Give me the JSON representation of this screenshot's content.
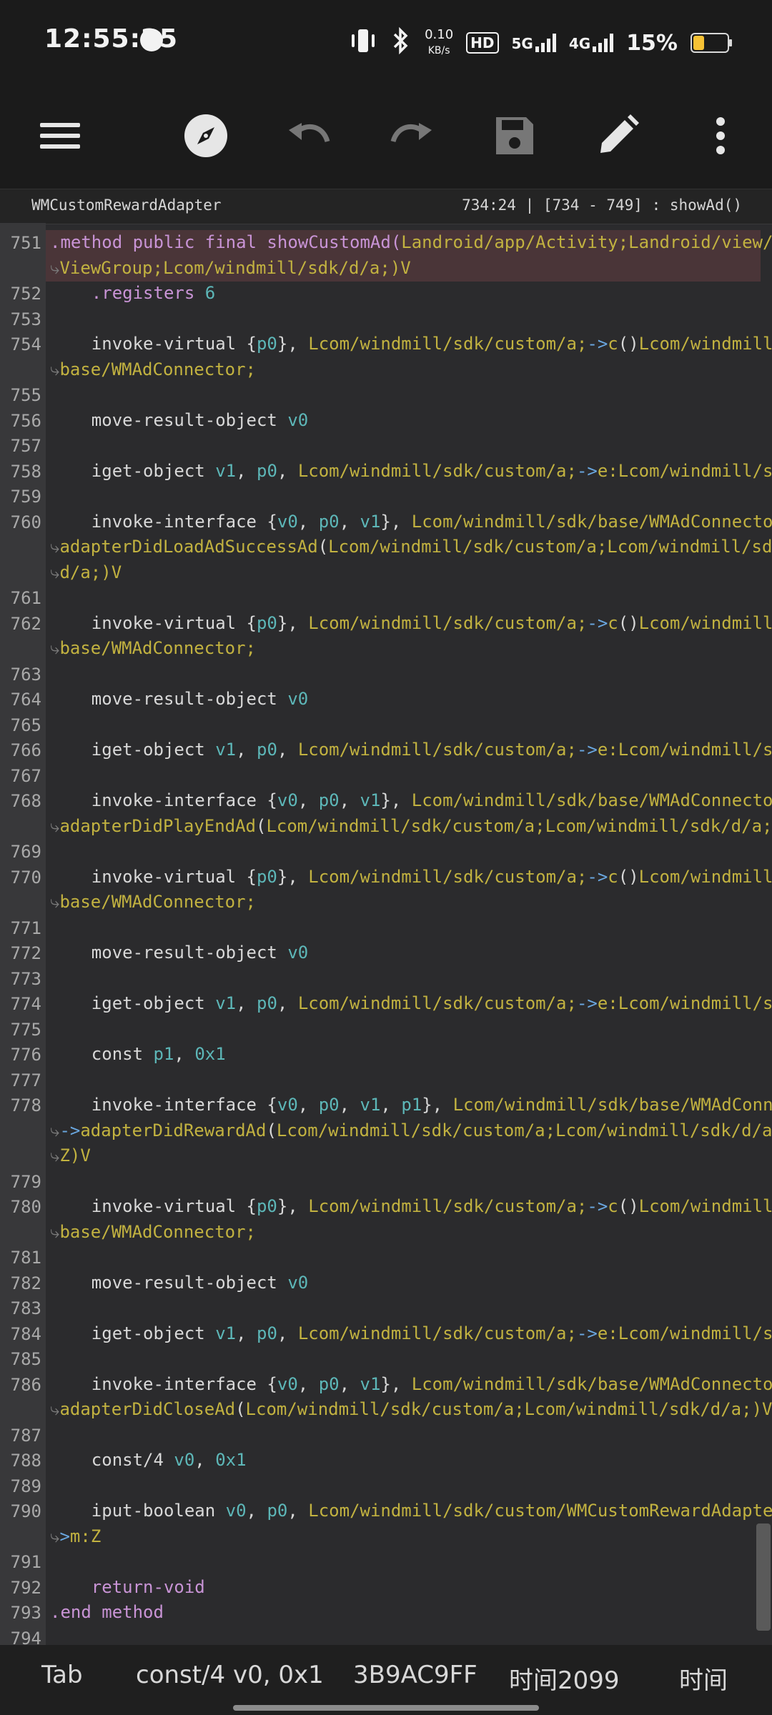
{
  "status": {
    "time": "12:55:25",
    "net_speed_value": "0.10",
    "net_speed_unit": "KB/s",
    "hd": "HD",
    "network_5g": "5G",
    "network_4g": "4G",
    "battery_percent": "15%",
    "battery_level": 0.15
  },
  "toolbar": {
    "icons": [
      "menu-icon",
      "compass-icon",
      "undo-icon",
      "redo-icon",
      "save-icon",
      "edit-icon",
      "more-vertical-icon"
    ]
  },
  "pathbar": {
    "file_name": "WMCustomRewardAdapter",
    "cursor_info": "734:24  |  [734 - 749] : showAd()"
  },
  "code_lines": [
    {
      "n": "751",
      "segs": [
        [
          ".method public final showCustomAd(",
          "dir"
        ],
        [
          "Landroid/app/Activity;Landroid/view/",
          "typ"
        ],
        [
          " ⤦",
          "wrap-marker"
        ]
      ]
    },
    {
      "n": "",
      "segs": [
        [
          "⤷",
          "wrap-marker"
        ],
        [
          "ViewGroup;Lcom/windmill/sdk/d/a;",
          "typ"
        ],
        [
          ")V",
          "typ"
        ]
      ]
    },
    {
      "n": "752",
      "segs": [
        [
          "    .registers ",
          "dir"
        ],
        [
          "6",
          "num"
        ]
      ]
    },
    {
      "n": "753",
      "segs": []
    },
    {
      "n": "754",
      "segs": [
        [
          "    invoke-virtual {",
          "plain"
        ],
        [
          "p0",
          "reg"
        ],
        [
          "}, ",
          "plain"
        ],
        [
          "Lcom/windmill/sdk/custom/a;",
          "typ"
        ],
        [
          "->",
          "arr"
        ],
        [
          "c",
          "m"
        ],
        [
          "()",
          "plain"
        ],
        [
          "Lcom/windmill/sdk/",
          "typ"
        ],
        [
          " ⤦",
          "wrap-marker"
        ]
      ]
    },
    {
      "n": "",
      "segs": [
        [
          "⤷",
          "wrap-marker"
        ],
        [
          "base/WMAdConnector;",
          "typ"
        ]
      ]
    },
    {
      "n": "755",
      "segs": []
    },
    {
      "n": "756",
      "segs": [
        [
          "    move-result-object ",
          "plain"
        ],
        [
          "v0",
          "reg"
        ]
      ]
    },
    {
      "n": "757",
      "segs": []
    },
    {
      "n": "758",
      "segs": [
        [
          "    iget-object ",
          "plain"
        ],
        [
          "v1",
          "reg"
        ],
        [
          ", ",
          "plain"
        ],
        [
          "p0",
          "reg"
        ],
        [
          ", ",
          "plain"
        ],
        [
          "Lcom/windmill/sdk/custom/a;",
          "typ"
        ],
        [
          "->",
          "arr"
        ],
        [
          "e:",
          "m"
        ],
        [
          "Lcom/windmill/sdk/d/a;",
          "typ"
        ]
      ]
    },
    {
      "n": "759",
      "segs": []
    },
    {
      "n": "760",
      "segs": [
        [
          "    invoke-interface {",
          "plain"
        ],
        [
          "v0",
          "reg"
        ],
        [
          ", ",
          "plain"
        ],
        [
          "p0",
          "reg"
        ],
        [
          ", ",
          "plain"
        ],
        [
          "v1",
          "reg"
        ],
        [
          "}, ",
          "plain"
        ],
        [
          "Lcom/windmill/sdk/base/WMAdConnector;",
          "typ"
        ],
        [
          "->",
          "arr"
        ],
        [
          " ⤦",
          "wrap-marker"
        ]
      ]
    },
    {
      "n": "",
      "segs": [
        [
          "⤷",
          "wrap-marker"
        ],
        [
          "adapterDidLoadAdSuccessAd",
          "m"
        ],
        [
          "(",
          "plain"
        ],
        [
          "Lcom/windmill/sdk/custom/a;Lcom/windmill/sdk/",
          "typ"
        ],
        [
          "⤦",
          "wrap-marker"
        ]
      ]
    },
    {
      "n": "",
      "segs": [
        [
          "⤷",
          "wrap-marker"
        ],
        [
          "d/a;",
          "typ"
        ],
        [
          ")V",
          "typ"
        ]
      ]
    },
    {
      "n": "761",
      "segs": []
    },
    {
      "n": "762",
      "segs": [
        [
          "    invoke-virtual {",
          "plain"
        ],
        [
          "p0",
          "reg"
        ],
        [
          "}, ",
          "plain"
        ],
        [
          "Lcom/windmill/sdk/custom/a;",
          "typ"
        ],
        [
          "->",
          "arr"
        ],
        [
          "c",
          "m"
        ],
        [
          "()",
          "plain"
        ],
        [
          "Lcom/windmill/sdk/",
          "typ"
        ],
        [
          " ⤦",
          "wrap-marker"
        ]
      ]
    },
    {
      "n": "",
      "segs": [
        [
          "⤷",
          "wrap-marker"
        ],
        [
          "base/WMAdConnector;",
          "typ"
        ]
      ]
    },
    {
      "n": "763",
      "segs": []
    },
    {
      "n": "764",
      "segs": [
        [
          "    move-result-object ",
          "plain"
        ],
        [
          "v0",
          "reg"
        ]
      ]
    },
    {
      "n": "765",
      "segs": []
    },
    {
      "n": "766",
      "segs": [
        [
          "    iget-object ",
          "plain"
        ],
        [
          "v1",
          "reg"
        ],
        [
          ", ",
          "plain"
        ],
        [
          "p0",
          "reg"
        ],
        [
          ", ",
          "plain"
        ],
        [
          "Lcom/windmill/sdk/custom/a;",
          "typ"
        ],
        [
          "->",
          "arr"
        ],
        [
          "e:",
          "m"
        ],
        [
          "Lcom/windmill/sdk/d/a;",
          "typ"
        ]
      ]
    },
    {
      "n": "767",
      "segs": []
    },
    {
      "n": "768",
      "segs": [
        [
          "    invoke-interface {",
          "plain"
        ],
        [
          "v0",
          "reg"
        ],
        [
          ", ",
          "plain"
        ],
        [
          "p0",
          "reg"
        ],
        [
          ", ",
          "plain"
        ],
        [
          "v1",
          "reg"
        ],
        [
          "}, ",
          "plain"
        ],
        [
          "Lcom/windmill/sdk/base/WMAdConnector;",
          "typ"
        ],
        [
          "->",
          "arr"
        ],
        [
          " ⤦",
          "wrap-marker"
        ]
      ]
    },
    {
      "n": "",
      "segs": [
        [
          "⤷",
          "wrap-marker"
        ],
        [
          "adapterDidPlayEndAd",
          "m"
        ],
        [
          "(",
          "plain"
        ],
        [
          "Lcom/windmill/sdk/custom/a;Lcom/windmill/sdk/d/a;",
          "typ"
        ],
        [
          ")V",
          "typ"
        ]
      ]
    },
    {
      "n": "769",
      "segs": []
    },
    {
      "n": "770",
      "segs": [
        [
          "    invoke-virtual {",
          "plain"
        ],
        [
          "p0",
          "reg"
        ],
        [
          "}, ",
          "plain"
        ],
        [
          "Lcom/windmill/sdk/custom/a;",
          "typ"
        ],
        [
          "->",
          "arr"
        ],
        [
          "c",
          "m"
        ],
        [
          "()",
          "plain"
        ],
        [
          "Lcom/windmill/sdk/",
          "typ"
        ],
        [
          " ⤦",
          "wrap-marker"
        ]
      ]
    },
    {
      "n": "",
      "segs": [
        [
          "⤷",
          "wrap-marker"
        ],
        [
          "base/WMAdConnector;",
          "typ"
        ]
      ]
    },
    {
      "n": "771",
      "segs": []
    },
    {
      "n": "772",
      "segs": [
        [
          "    move-result-object ",
          "plain"
        ],
        [
          "v0",
          "reg"
        ]
      ]
    },
    {
      "n": "773",
      "segs": []
    },
    {
      "n": "774",
      "segs": [
        [
          "    iget-object ",
          "plain"
        ],
        [
          "v1",
          "reg"
        ],
        [
          ", ",
          "plain"
        ],
        [
          "p0",
          "reg"
        ],
        [
          ", ",
          "plain"
        ],
        [
          "Lcom/windmill/sdk/custom/a;",
          "typ"
        ],
        [
          "->",
          "arr"
        ],
        [
          "e:",
          "m"
        ],
        [
          "Lcom/windmill/sdk/d/a;",
          "typ"
        ]
      ]
    },
    {
      "n": "775",
      "segs": []
    },
    {
      "n": "776",
      "segs": [
        [
          "    const ",
          "plain"
        ],
        [
          "p1",
          "reg"
        ],
        [
          ", ",
          "plain"
        ],
        [
          "0x1",
          "num"
        ]
      ]
    },
    {
      "n": "777",
      "segs": []
    },
    {
      "n": "778",
      "segs": [
        [
          "    invoke-interface {",
          "plain"
        ],
        [
          "v0",
          "reg"
        ],
        [
          ", ",
          "plain"
        ],
        [
          "p0",
          "reg"
        ],
        [
          ", ",
          "plain"
        ],
        [
          "v1",
          "reg"
        ],
        [
          ", ",
          "plain"
        ],
        [
          "p1",
          "reg"
        ],
        [
          "}, ",
          "plain"
        ],
        [
          "Lcom/windmill/sdk/base/WMAdConnector;",
          "typ"
        ],
        [
          "⤦",
          "wrap-marker"
        ]
      ]
    },
    {
      "n": "",
      "segs": [
        [
          "⤷",
          "wrap-marker"
        ],
        [
          "->",
          "arr"
        ],
        [
          "adapterDidRewardAd",
          "m"
        ],
        [
          "(",
          "plain"
        ],
        [
          "Lcom/windmill/sdk/custom/a;Lcom/windmill/sdk/d/a;",
          "typ"
        ],
        [
          "⤦",
          "wrap-marker"
        ]
      ]
    },
    {
      "n": "",
      "segs": [
        [
          "⤷",
          "wrap-marker"
        ],
        [
          "Z",
          "typ"
        ],
        [
          ")V",
          "typ"
        ]
      ]
    },
    {
      "n": "779",
      "segs": []
    },
    {
      "n": "780",
      "segs": [
        [
          "    invoke-virtual {",
          "plain"
        ],
        [
          "p0",
          "reg"
        ],
        [
          "}, ",
          "plain"
        ],
        [
          "Lcom/windmill/sdk/custom/a;",
          "typ"
        ],
        [
          "->",
          "arr"
        ],
        [
          "c",
          "m"
        ],
        [
          "()",
          "plain"
        ],
        [
          "Lcom/windmill/sdk/",
          "typ"
        ],
        [
          " ⤦",
          "wrap-marker"
        ]
      ]
    },
    {
      "n": "",
      "segs": [
        [
          "⤷",
          "wrap-marker"
        ],
        [
          "base/WMAdConnector;",
          "typ"
        ]
      ]
    },
    {
      "n": "781",
      "segs": []
    },
    {
      "n": "782",
      "segs": [
        [
          "    move-result-object ",
          "plain"
        ],
        [
          "v0",
          "reg"
        ]
      ]
    },
    {
      "n": "783",
      "segs": []
    },
    {
      "n": "784",
      "segs": [
        [
          "    iget-object ",
          "plain"
        ],
        [
          "v1",
          "reg"
        ],
        [
          ", ",
          "plain"
        ],
        [
          "p0",
          "reg"
        ],
        [
          ", ",
          "plain"
        ],
        [
          "Lcom/windmill/sdk/custom/a;",
          "typ"
        ],
        [
          "->",
          "arr"
        ],
        [
          "e:",
          "m"
        ],
        [
          "Lcom/windmill/sdk/d/a;",
          "typ"
        ]
      ]
    },
    {
      "n": "785",
      "segs": []
    },
    {
      "n": "786",
      "segs": [
        [
          "    invoke-interface {",
          "plain"
        ],
        [
          "v0",
          "reg"
        ],
        [
          ", ",
          "plain"
        ],
        [
          "p0",
          "reg"
        ],
        [
          ", ",
          "plain"
        ],
        [
          "v1",
          "reg"
        ],
        [
          "}, ",
          "plain"
        ],
        [
          "Lcom/windmill/sdk/base/WMAdConnector;",
          "typ"
        ],
        [
          "->",
          "arr"
        ],
        [
          " ⤦",
          "wrap-marker"
        ]
      ]
    },
    {
      "n": "",
      "segs": [
        [
          "⤷",
          "wrap-marker"
        ],
        [
          "adapterDidCloseAd",
          "m"
        ],
        [
          "(",
          "plain"
        ],
        [
          "Lcom/windmill/sdk/custom/a;Lcom/windmill/sdk/d/a;",
          "typ"
        ],
        [
          ")V",
          "typ"
        ]
      ]
    },
    {
      "n": "787",
      "segs": []
    },
    {
      "n": "788",
      "segs": [
        [
          "    const/4 ",
          "plain"
        ],
        [
          "v0",
          "reg"
        ],
        [
          ", ",
          "plain"
        ],
        [
          "0x1",
          "num"
        ]
      ]
    },
    {
      "n": "789",
      "segs": []
    },
    {
      "n": "790",
      "segs": [
        [
          "    iput-boolean ",
          "plain"
        ],
        [
          "v0",
          "reg"
        ],
        [
          ", ",
          "plain"
        ],
        [
          "p0",
          "reg"
        ],
        [
          ", ",
          "plain"
        ],
        [
          "Lcom/windmill/sdk/custom/WMCustomRewardAdapter;",
          "typ"
        ],
        [
          "-",
          "arr"
        ],
        [
          "⤦",
          "wrap-marker"
        ]
      ]
    },
    {
      "n": "",
      "segs": [
        [
          "⤷",
          "wrap-marker"
        ],
        [
          ">",
          "arr"
        ],
        [
          "m:",
          "m"
        ],
        [
          "Z",
          "typ"
        ]
      ]
    },
    {
      "n": "791",
      "segs": []
    },
    {
      "n": "792",
      "segs": [
        [
          "    return-void",
          "dir"
        ]
      ]
    },
    {
      "n": "793",
      "segs": [
        [
          ".end method",
          "dir"
        ]
      ]
    },
    {
      "n": "794",
      "segs": []
    }
  ],
  "bottombar": {
    "tab": "Tab",
    "const": "const/4 v0, 0x1",
    "hex": "3B9AC9FF",
    "time_snippet": "时间2099",
    "time_label": "时间"
  }
}
